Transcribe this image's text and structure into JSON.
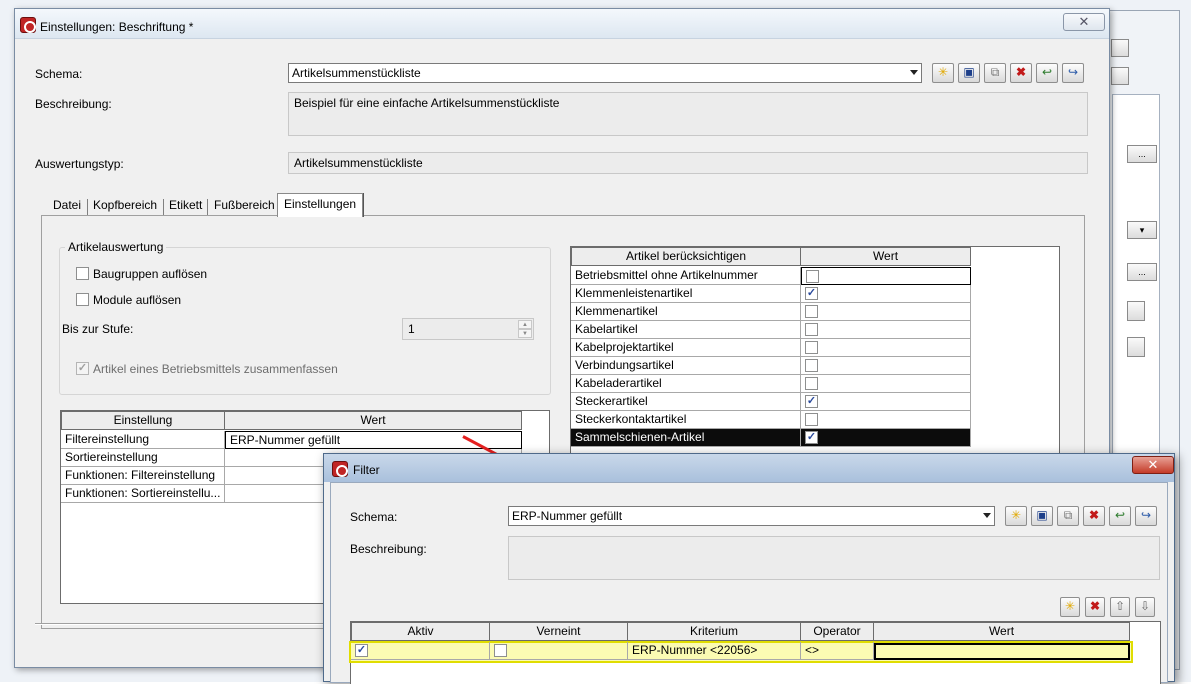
{
  "main": {
    "title": "Einstellungen: Beschriftung *",
    "close": "✕",
    "schema_label": "Schema:",
    "schema_value": "Artikelsummenstückliste",
    "desc_label": "Beschreibung:",
    "desc_value": "Beispiel für eine einfache Artikelsummenstückliste",
    "type_label": "Auswertungstyp:",
    "type_value": "Artikelsummenstückliste",
    "tabs": [
      "Datei",
      "Kopfbereich",
      "Etikett",
      "Fußbereich",
      "Einstellungen"
    ],
    "group_title": "Artikelauswertung",
    "cb_baugruppen": "Baugruppen auflösen",
    "cb_module": "Module auflösen",
    "stufe_label": "Bis zur Stufe:",
    "stufe_value": "1",
    "cb_zusammen": "Artikel eines Betriebsmittels zusammenfassen",
    "settings_grid": {
      "headers": [
        "Einstellung",
        "Wert"
      ],
      "rows": [
        {
          "name": "Filtereinstellung",
          "value": "ERP-Nummer gefüllt"
        },
        {
          "name": "Sortiereinstellung",
          "value": ""
        },
        {
          "name": "Funktionen: Filtereinstellung",
          "value": ""
        },
        {
          "name": "Funktionen: Sortiereinstellu...",
          "value": ""
        }
      ]
    },
    "article_grid": {
      "headers": [
        "Artikel berücksichtigen",
        "Wert"
      ],
      "rows": [
        {
          "name": "Betriebsmittel ohne Artikelnummer",
          "checked": false
        },
        {
          "name": "Klemmenleistenartikel",
          "checked": true
        },
        {
          "name": "Klemmenartikel",
          "checked": false
        },
        {
          "name": "Kabelartikel",
          "checked": false
        },
        {
          "name": "Kabelprojektartikel",
          "checked": false
        },
        {
          "name": "Verbindungsartikel",
          "checked": false
        },
        {
          "name": "Kabeladerartikel",
          "checked": false
        },
        {
          "name": "Steckerartikel",
          "checked": true
        },
        {
          "name": "Steckerkontaktartikel",
          "checked": false
        },
        {
          "name": "Sammelschienen-Artikel",
          "checked": true
        }
      ]
    }
  },
  "filter": {
    "title": "Filter",
    "close": "✕",
    "schema_label": "Schema:",
    "schema_value": "ERP-Nummer gefüllt",
    "desc_label": "Beschreibung:",
    "grid_headers": [
      "Aktiv",
      "Verneint",
      "Kriterium",
      "Operator",
      "Wert"
    ],
    "row": {
      "aktiv": true,
      "verneint": false,
      "kriterium": "ERP-Nummer <22056>",
      "operator": "<>",
      "wert": ""
    }
  },
  "toolbar_icons": [
    "new-icon",
    "save-icon",
    "copy-icon",
    "delete-icon",
    "import-icon",
    "export-icon"
  ],
  "colors": {
    "selection": "#0c0c0c",
    "highlight_row": "#fbfbb3",
    "highlight_border": "#e0dd00",
    "arrow": "#e52020"
  }
}
